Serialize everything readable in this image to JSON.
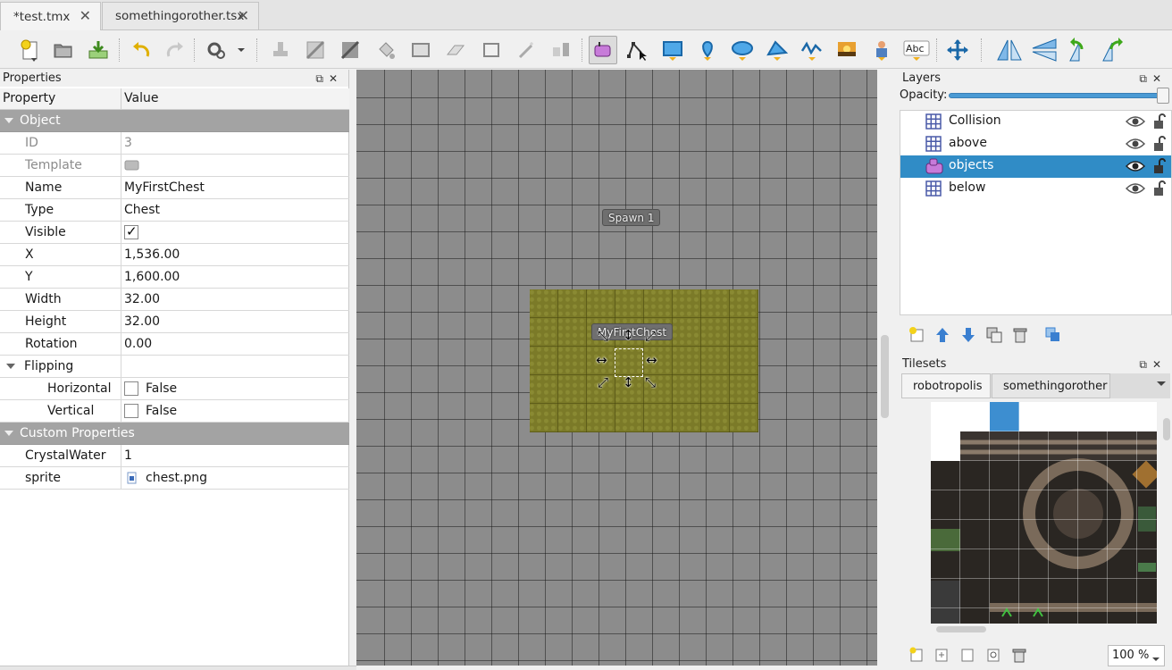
{
  "tabs": [
    {
      "label": "*test.tmx",
      "active": true
    },
    {
      "label": "somethingorother.tsx",
      "active": false
    }
  ],
  "toolbar": {
    "icons": [
      "new-map-icon",
      "open-icon",
      "save-icon",
      "undo-icon",
      "redo-icon",
      "commands-icon",
      "stamp-brush-icon",
      "terrain-brush-icon",
      "wang-brush-icon",
      "bucket-fill-icon",
      "shape-fill-icon",
      "eraser-icon",
      "rect-select-icon",
      "magic-wand-icon",
      "select-same-tile-icon",
      "select-objects-icon",
      "edit-polygons-icon",
      "insert-rectangle-icon",
      "insert-point-icon",
      "insert-ellipse-icon",
      "insert-polygon-icon",
      "insert-polyline-icon",
      "insert-tile-icon",
      "insert-template-icon",
      "insert-text-icon",
      "tile-offset-icon",
      "flip-horizontal-icon",
      "flip-vertical-icon",
      "rotate-left-icon",
      "rotate-right-icon"
    ]
  },
  "properties": {
    "title": "Properties",
    "col_property": "Property",
    "col_value": "Value",
    "group_object": "Object",
    "id_label": "ID",
    "id_value": "3",
    "template_label": "Template",
    "name_label": "Name",
    "name_value": "MyFirstChest",
    "type_label": "Type",
    "type_value": "Chest",
    "visible_label": "Visible",
    "visible_value": true,
    "x_label": "X",
    "x_value": "1,536.00",
    "y_label": "Y",
    "y_value": "1,600.00",
    "width_label": "Width",
    "width_value": "32.00",
    "height_label": "Height",
    "height_value": "32.00",
    "rotation_label": "Rotation",
    "rotation_value": "0.00",
    "flipping_label": "Flipping",
    "horizontal_label": "Horizontal",
    "horizontal_value": "False",
    "vertical_label": "Vertical",
    "vertical_value": "False",
    "group_custom": "Custom Properties",
    "crystal_label": "CrystalWater",
    "crystal_value": "1",
    "sprite_label": "sprite",
    "sprite_value": "chest.png"
  },
  "map": {
    "spawn_label": "Spawn 1",
    "chest_label": "MyFirstChest",
    "grass_color": "#7b7a28"
  },
  "layers": {
    "title": "Layers",
    "opacity_label": "Opacity:",
    "opacity": 1.0,
    "items": [
      {
        "name": "Collision",
        "kind": "tile",
        "selected": false
      },
      {
        "name": "above",
        "kind": "tile",
        "selected": false
      },
      {
        "name": "objects",
        "kind": "object",
        "selected": true
      },
      {
        "name": "below",
        "kind": "tile",
        "selected": false
      }
    ]
  },
  "tilesets": {
    "title": "Tilesets",
    "tabs": [
      "robotropolis",
      "somethingorother"
    ],
    "zoom": "100 %"
  },
  "colors": {
    "accent": "#308cc6",
    "group_header": "#a3a3a3",
    "canvas": "#8c8c8c"
  }
}
